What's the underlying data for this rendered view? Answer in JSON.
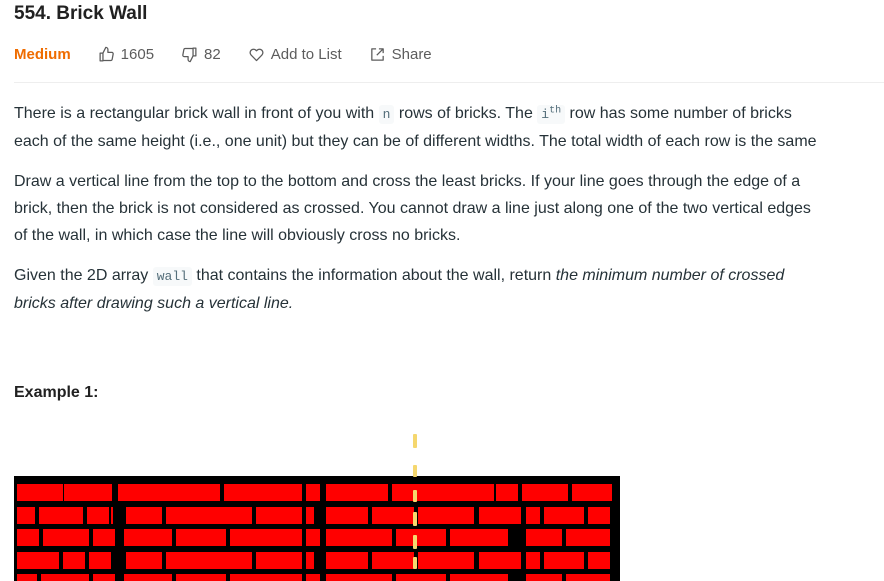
{
  "problem": {
    "title": "554. Brick Wall",
    "difficulty": "Medium",
    "likes": "1605",
    "dislikes": "82",
    "add_to_list": "Add to List",
    "share": "Share"
  },
  "description": {
    "p1_a": "There is a rectangular brick wall in front of you with ",
    "p1_code": "n",
    "p1_b": " rows of bricks. The ",
    "p1_code2": "i",
    "p1_sup": "th",
    "p1_c": " row has some number of bricks",
    "p1_line2": "each of the same height (i.e., one unit) but they can be of different widths. The total width of each row is the same",
    "p2_line1": "Draw a vertical line from the top to the bottom and cross the least bricks. If your line goes through the edge of a",
    "p2_line2": "brick, then the brick is not considered as crossed. You cannot draw a line just along one of the two vertical edges",
    "p2_line3": "of the wall, in which case the line will obviously cross no bricks.",
    "p3_a": "Given the 2D array ",
    "p3_code": "wall",
    "p3_b": " that contains the information about the wall, return ",
    "p3_em1": "the minimum number of crossed",
    "p3_em2": "bricks after drawing such a vertical line."
  },
  "example": {
    "title": "Example 1:"
  },
  "colors": {
    "brick": "#ff0000",
    "mortar": "#000000",
    "line": "#f5d76e",
    "difficulty": "#ef6c00"
  }
}
